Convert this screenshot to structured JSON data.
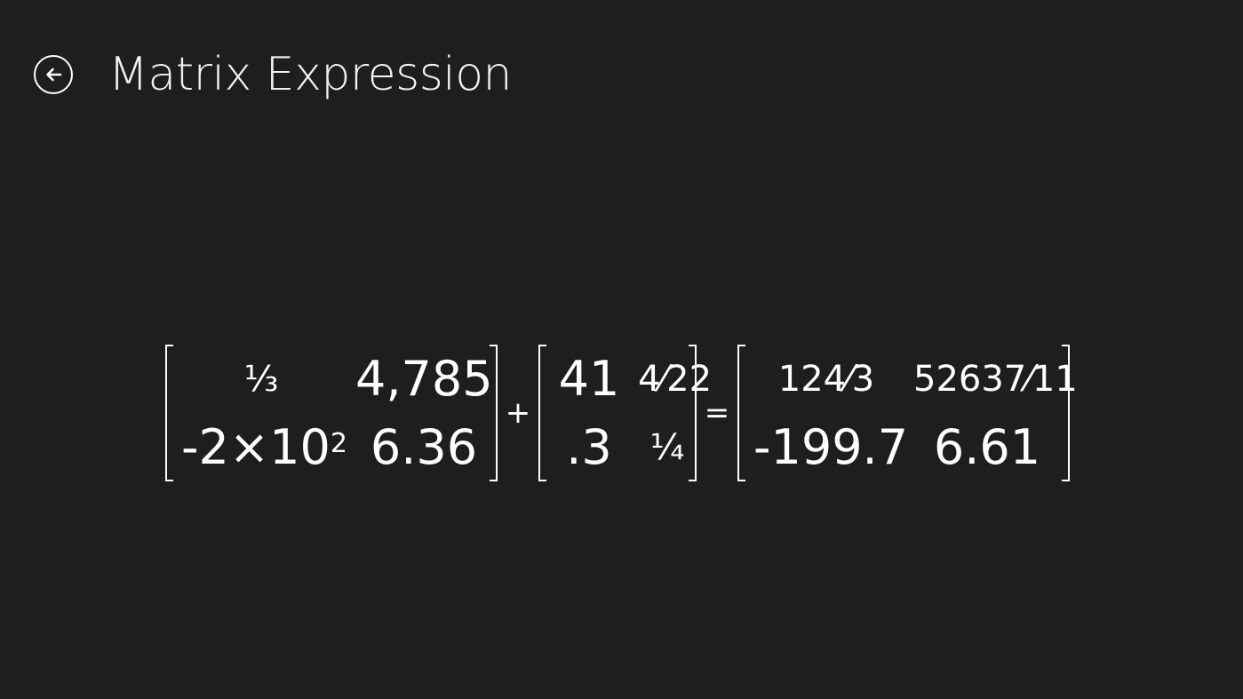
{
  "header": {
    "back_icon": "back-arrow-icon",
    "title": "Matrix Expression"
  },
  "expression": {
    "operator_plus": "+",
    "operator_equals": "=",
    "matrix_a": {
      "r1c1": "⅓",
      "r1c2": "4,785",
      "r2c1_base": "-2×10",
      "r2c1_exp": "2",
      "r2c2": "6.36"
    },
    "matrix_b": {
      "r1c1": "41",
      "r1c2": "4⁄22",
      "r2c1": ".3",
      "r2c2": "¼"
    },
    "result": {
      "r1c1": "124⁄3",
      "r1c2": "52637⁄11",
      "r2c1": "-199.7",
      "r2c2": "6.61"
    }
  },
  "colors": {
    "background": "#1e1e1e",
    "foreground": "#ffffff"
  }
}
